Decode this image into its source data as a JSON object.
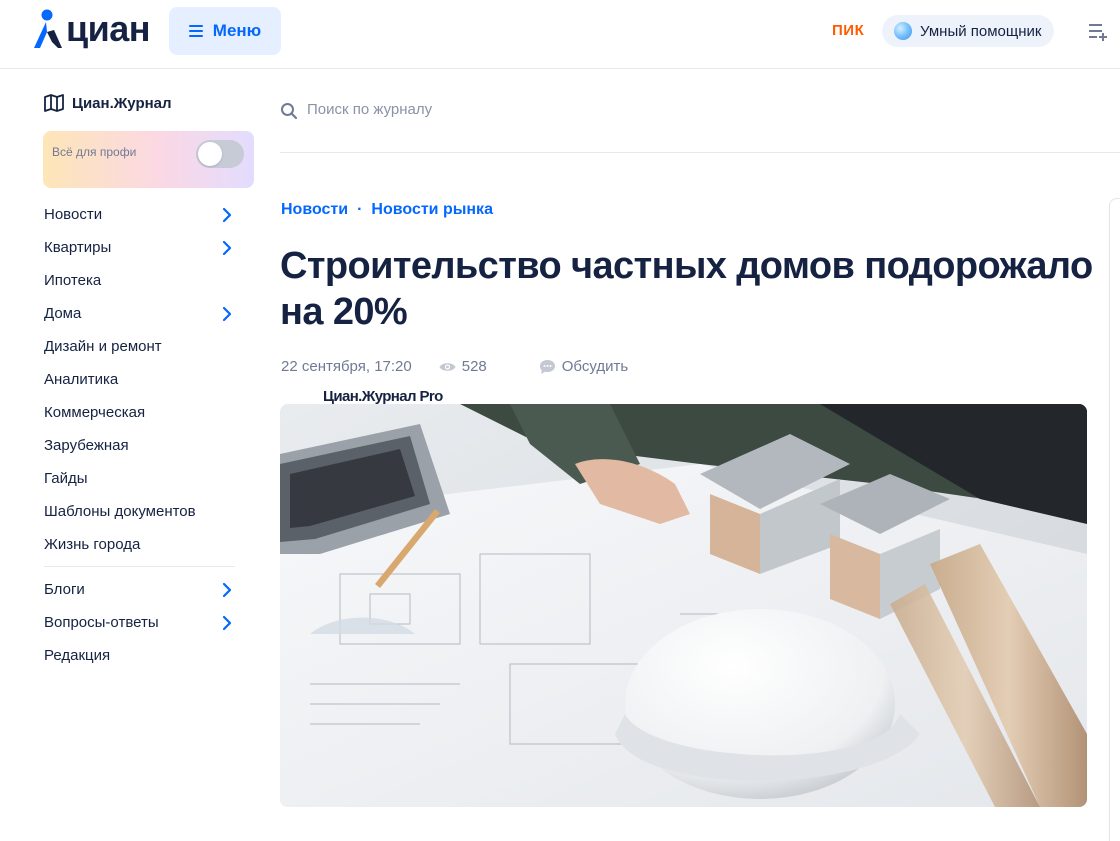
{
  "header": {
    "logo_text": "циан",
    "menu_label": "Меню",
    "partner_label": "ПИК",
    "assistant_label": "Умный помощник",
    "accent_color": "#0468ff"
  },
  "sidebar": {
    "journal_label": "Циан.Журнал",
    "pro": {
      "title": "Циан.Журнал Pro",
      "subtitle": "Всё для профи",
      "toggle_on": false
    },
    "items": [
      {
        "label": "Новости",
        "has_arrow": true
      },
      {
        "label": "Квартиры",
        "has_arrow": true
      },
      {
        "label": "Ипотека",
        "has_arrow": false
      },
      {
        "label": "Дома",
        "has_arrow": true
      },
      {
        "label": "Дизайн и ремонт",
        "has_arrow": false
      },
      {
        "label": "Аналитика",
        "has_arrow": false
      },
      {
        "label": "Коммерческая",
        "has_arrow": false
      },
      {
        "label": "Зарубежная",
        "has_arrow": false
      },
      {
        "label": "Гайды",
        "has_arrow": false
      },
      {
        "label": "Шаблоны документов",
        "has_arrow": false
      },
      {
        "label": "Жизнь города",
        "has_arrow": false
      }
    ],
    "items2": [
      {
        "label": "Блоги",
        "has_arrow": true
      },
      {
        "label": "Вопросы-ответы",
        "has_arrow": true
      },
      {
        "label": "Редакция",
        "has_arrow": false
      }
    ]
  },
  "search": {
    "placeholder": "Поиск по журналу",
    "value": ""
  },
  "article": {
    "breadcrumbs": [
      "Новости",
      "Новости рынка"
    ],
    "title": "Строительство частных домов подорожало на 20%",
    "date": "22 сентября, 17:20",
    "views": "528",
    "discuss_label": "Обсудить",
    "image_icon": "architect-desk-photo"
  }
}
